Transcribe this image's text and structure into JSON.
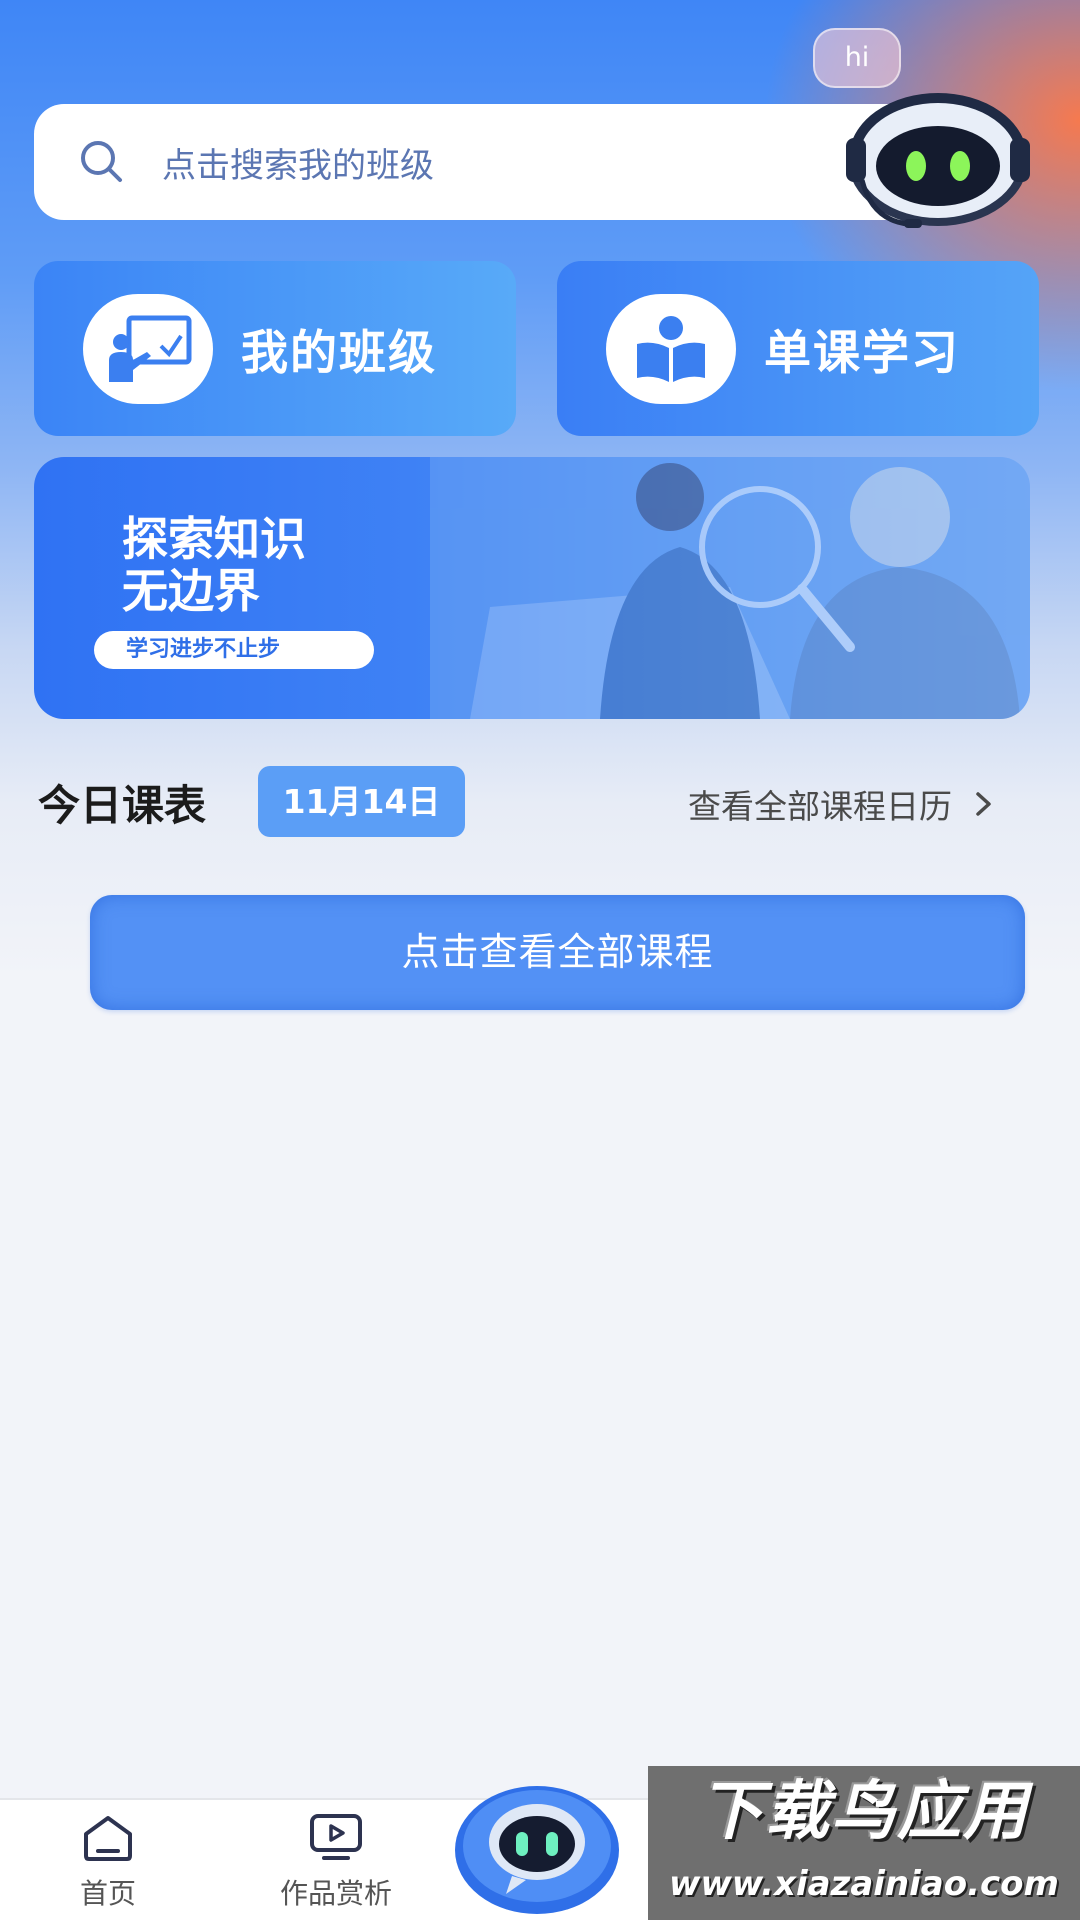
{
  "header": {
    "hi_bubble": "hi",
    "search": {
      "placeholder": "点击搜索我的班级"
    }
  },
  "entries": [
    {
      "label": "我的班级",
      "icon": "classroom-teacher-icon"
    },
    {
      "label": "单课学习",
      "icon": "reading-student-icon"
    }
  ],
  "banner": {
    "title_line1": "探索知识",
    "title_line2": "无边界",
    "tag": "学习进步不止步"
  },
  "schedule": {
    "title": "今日课表",
    "date": "11月14日",
    "calendar_link": "查看全部课程日历",
    "view_all_button": "点击查看全部课程"
  },
  "tab_bar": {
    "home": {
      "label": "首页",
      "icon": "home-icon"
    },
    "works": {
      "label": "作品赏析",
      "icon": "video-play-icon"
    },
    "assistant": {
      "icon": "robot-icon"
    }
  },
  "watermark": {
    "top": "下载鸟应用",
    "bottom": "www.xiazainiao.com"
  },
  "colors": {
    "primary_blue": "#3b84f6",
    "accent_orange": "#ff7846",
    "date_badge": "#5b9ef6"
  }
}
